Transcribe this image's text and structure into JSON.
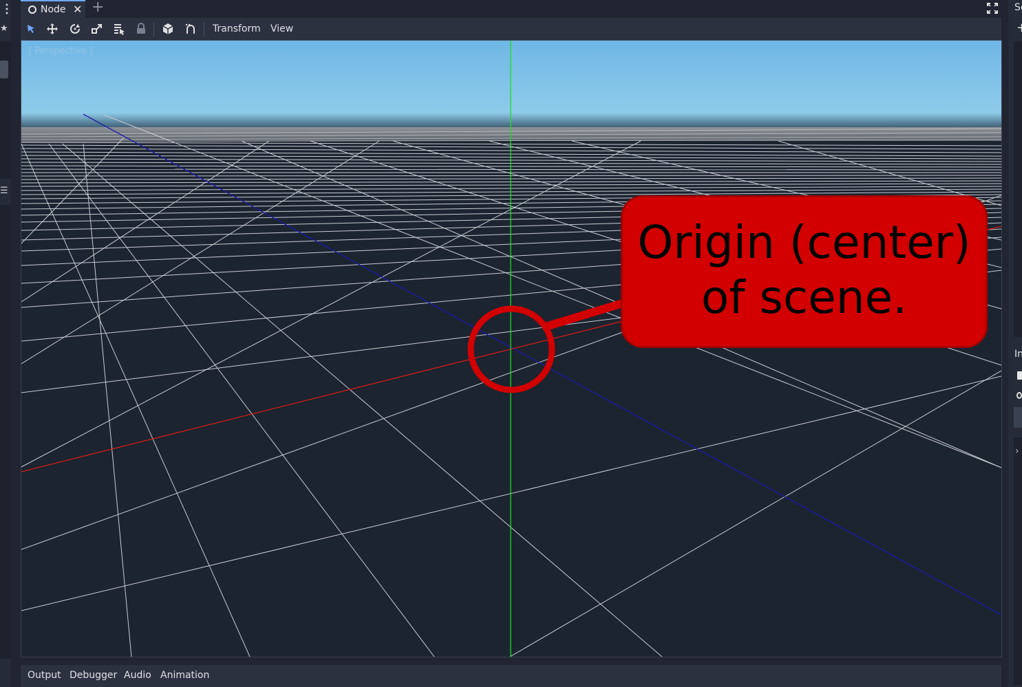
{
  "scene_tabs": [
    {
      "label": "Node",
      "icon": "node-circle-icon",
      "close_icon": "close-icon"
    }
  ],
  "add_tab_label": "+",
  "toolbar": {
    "tools": [
      "select-tool-icon",
      "move-tool-icon",
      "rotate-tool-icon",
      "scale-tool-icon",
      "list-select-icon",
      "lock-icon",
      "local-space-icon",
      "snap-icon"
    ],
    "menus": [
      "Transform",
      "View"
    ]
  },
  "viewport": {
    "label": "[ Perspective ]",
    "colors": {
      "sky_top": "#6fb7e6",
      "sky_horizon": "#8ecbe9",
      "ground": "#1c2430",
      "x_axis": "#d11b1b",
      "y_axis": "#1fdc1f",
      "z_axis": "#1a1aaa",
      "annotation": "#d20000"
    }
  },
  "callout": {
    "line1": "Origin (center)",
    "line2": "of scene."
  },
  "bottom_panel": {
    "tabs": [
      "Output",
      "Debugger",
      "Audio",
      "Animation"
    ]
  },
  "right_dock": {
    "scene_tab_partial": "Sc",
    "inspector_tab_partial": "In"
  }
}
